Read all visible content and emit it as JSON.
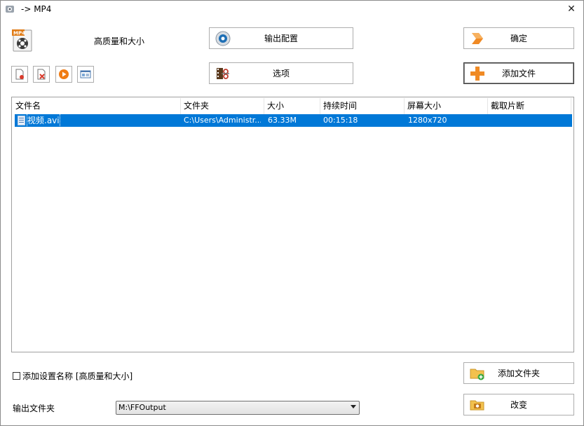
{
  "window": {
    "title": "-> MP4",
    "close_glyph": "✕"
  },
  "profile": {
    "icon": "mp4-film-icon",
    "badge": "MP4",
    "label": "高质量和大小"
  },
  "buttons": {
    "output_config": {
      "label": "输出配置",
      "icon": "settings-disc-icon"
    },
    "ok": {
      "label": "确定",
      "icon": "orange-arrow-icon"
    },
    "options": {
      "label": "选项",
      "icon": "film-scissors-icon"
    },
    "add_file": {
      "label": "添加文件",
      "icon": "orange-plus-icon"
    },
    "add_folder": {
      "label": "添加文件夹",
      "icon": "folder-add-icon"
    },
    "change": {
      "label": "改变",
      "icon": "folder-camera-icon"
    }
  },
  "toolbar_icons": [
    "remove-file-icon",
    "clear-list-icon",
    "play-icon",
    "media-info-icon"
  ],
  "filelist": {
    "columns": [
      "文件名",
      "文件夹",
      "大小",
      "持续时间",
      "屏幕大小",
      "截取片断"
    ],
    "rows": [
      {
        "name": "视频.avi",
        "folder": "C:\\Users\\Administr...",
        "size": "63.33M",
        "duration": "00:15:18",
        "screen": "1280x720",
        "clip": ""
      }
    ],
    "selected_color": "#0078d7"
  },
  "checkbox": {
    "label": "添加设置名称 [高质量和大小]",
    "checked": false
  },
  "output": {
    "label": "输出文件夹",
    "value": "M:\\FFOutput"
  }
}
